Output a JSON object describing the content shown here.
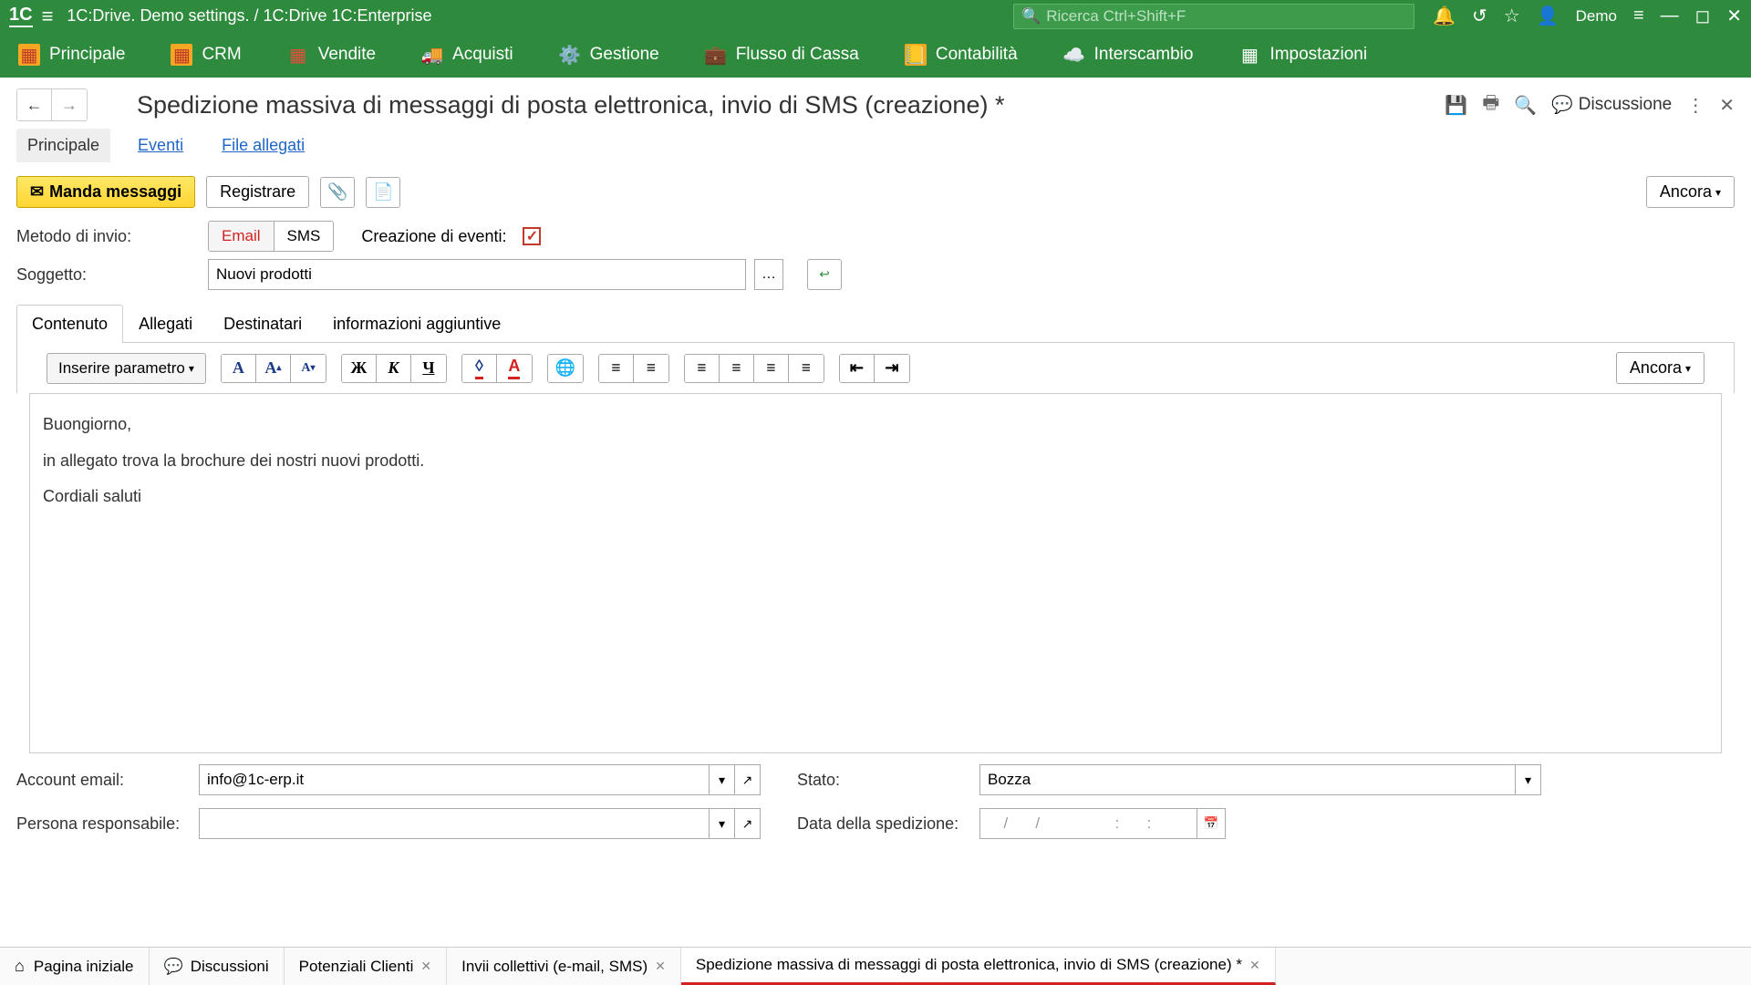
{
  "titlebar": {
    "app_title": "1C:Drive. Demo settings. / 1C:Drive 1C:Enterprise",
    "search_placeholder": "Ricerca Ctrl+Shift+F",
    "demo_label": "Demo"
  },
  "mainnav": {
    "items": [
      "Principale",
      "CRM",
      "Vendite",
      "Acquisti",
      "Gestione",
      "Flusso di Cassa",
      "Contabilità",
      "Interscambio",
      "Impostazioni"
    ]
  },
  "page": {
    "title": "Spedizione massiva di messaggi di posta elettronica, invio di SMS (creazione) *",
    "discussione": "Discussione"
  },
  "page_tabs": {
    "principale": "Principale",
    "eventi": "Eventi",
    "file_allegati": "File allegati"
  },
  "toolbar": {
    "send": "Manda messaggi",
    "register": "Registrare",
    "ancora": "Ancora"
  },
  "form": {
    "method_label": "Metodo di invio:",
    "email": "Email",
    "sms": "SMS",
    "create_events": "Creazione di eventi:",
    "subject_label": "Soggetto:",
    "subject_value": "Nuovi prodotti"
  },
  "content_tabs": {
    "contenuto": "Contenuto",
    "allegati": "Allegati",
    "destinatari": "Destinatari",
    "info": "informazioni aggiuntive"
  },
  "editor": {
    "insert_param": "Inserire parametro",
    "ancora": "Ancora",
    "body_line1": "Buongiorno,",
    "body_line2": "in allegato trova la brochure dei nostri nuovi prodotti.",
    "body_line3": "Cordiali saluti"
  },
  "bottom_form": {
    "account_label": "Account email:",
    "account_value": "info@1c-erp.it",
    "stato_label": "Stato:",
    "stato_value": "Bozza",
    "persona_label": "Persona responsabile:",
    "persona_value": "",
    "data_label": "Data della spedizione:",
    "data_value": "  /   /         :   :"
  },
  "bottom_tabs": {
    "home": "Pagina iniziale",
    "discussioni": "Discussioni",
    "tab1": "Potenziali Clienti",
    "tab2": "Invii collettivi (e-mail, SMS)",
    "tab3": "Spedizione massiva di messaggi di posta elettronica, invio di SMS (creazione) *"
  }
}
